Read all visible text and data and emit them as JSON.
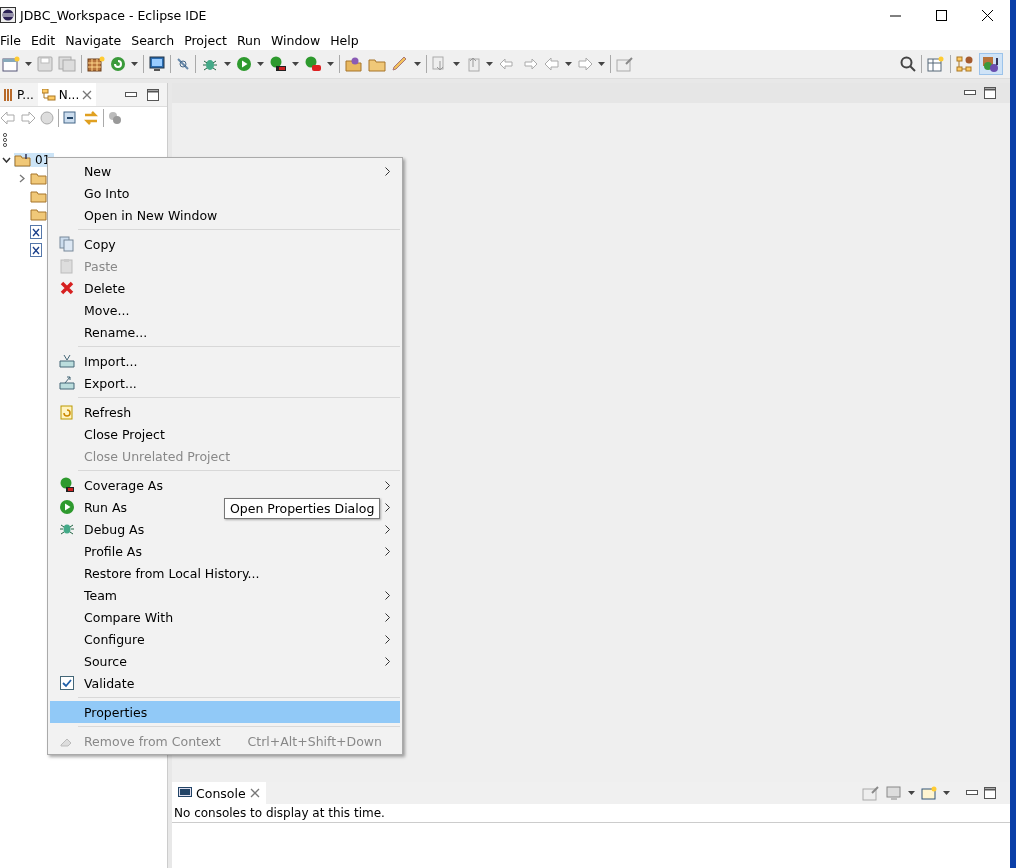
{
  "window": {
    "title": "JDBC_Workspace - Eclipse IDE"
  },
  "menubar": [
    "File",
    "Edit",
    "Navigate",
    "Search",
    "Project",
    "Run",
    "Window",
    "Help"
  ],
  "left_panel": {
    "tabs": [
      {
        "label": "P...",
        "selected": false
      },
      {
        "label": "N...",
        "selected": true
      }
    ],
    "tree": [
      {
        "label": "01",
        "kind": "project",
        "expanded": true,
        "selected": true,
        "children": [
          {
            "kind": "folder",
            "expanded": false
          },
          {
            "kind": "folder"
          },
          {
            "kind": "folder"
          },
          {
            "kind": "file"
          },
          {
            "kind": "file"
          }
        ]
      }
    ]
  },
  "context_menu": [
    {
      "kind": "item",
      "label": "New",
      "submenu": true,
      "disabled": false,
      "selected": false
    },
    {
      "kind": "item",
      "label": "Go Into",
      "submenu": false,
      "disabled": false,
      "selected": false
    },
    {
      "kind": "item",
      "label": "Open in New Window",
      "submenu": false,
      "disabled": false,
      "selected": false
    },
    {
      "kind": "separator"
    },
    {
      "kind": "item",
      "label": "Copy",
      "submenu": false,
      "disabled": false,
      "selected": false
    },
    {
      "kind": "item",
      "label": "Paste",
      "submenu": false,
      "disabled": true,
      "selected": false
    },
    {
      "kind": "item",
      "label": "Delete",
      "submenu": false,
      "disabled": false,
      "selected": false
    },
    {
      "kind": "item",
      "label": "Move...",
      "submenu": false,
      "disabled": false,
      "selected": false
    },
    {
      "kind": "item",
      "label": "Rename...",
      "submenu": false,
      "disabled": false,
      "selected": false
    },
    {
      "kind": "separator"
    },
    {
      "kind": "item",
      "label": "Import...",
      "submenu": false,
      "disabled": false,
      "selected": false
    },
    {
      "kind": "item",
      "label": "Export...",
      "submenu": false,
      "disabled": false,
      "selected": false
    },
    {
      "kind": "separator"
    },
    {
      "kind": "item",
      "label": "Refresh",
      "submenu": false,
      "disabled": false,
      "selected": false
    },
    {
      "kind": "item",
      "label": "Close Project",
      "submenu": false,
      "disabled": false,
      "selected": false
    },
    {
      "kind": "item",
      "label": "Close Unrelated Project",
      "submenu": false,
      "disabled": true,
      "selected": false
    },
    {
      "kind": "separator"
    },
    {
      "kind": "item",
      "label": "Coverage As",
      "submenu": true,
      "disabled": false,
      "selected": false
    },
    {
      "kind": "item",
      "label": "Run As",
      "submenu": true,
      "disabled": false,
      "selected": false
    },
    {
      "kind": "item",
      "label": "Debug As",
      "submenu": true,
      "disabled": false,
      "selected": false
    },
    {
      "kind": "item",
      "label": "Profile As",
      "submenu": true,
      "disabled": false,
      "selected": false
    },
    {
      "kind": "item",
      "label": "Restore from Local History...",
      "submenu": false,
      "disabled": false,
      "selected": false
    },
    {
      "kind": "item",
      "label": "Team",
      "submenu": true,
      "disabled": false,
      "selected": false
    },
    {
      "kind": "item",
      "label": "Compare With",
      "submenu": true,
      "disabled": false,
      "selected": false
    },
    {
      "kind": "item",
      "label": "Configure",
      "submenu": true,
      "disabled": false,
      "selected": false
    },
    {
      "kind": "item",
      "label": "Source",
      "submenu": true,
      "disabled": false,
      "selected": false
    },
    {
      "kind": "item",
      "label": "Validate",
      "submenu": false,
      "disabled": false,
      "selected": false
    },
    {
      "kind": "separator"
    },
    {
      "kind": "item",
      "label": "Properties",
      "submenu": false,
      "disabled": false,
      "selected": true
    },
    {
      "kind": "separator"
    },
    {
      "kind": "item",
      "label": "Remove from Context",
      "shortcut": "Ctrl+Alt+Shift+Down",
      "submenu": false,
      "disabled": true,
      "selected": false
    }
  ],
  "tooltip": "Open Properties Dialog",
  "console": {
    "tab": "Console",
    "message": "No consoles to display at this time."
  }
}
